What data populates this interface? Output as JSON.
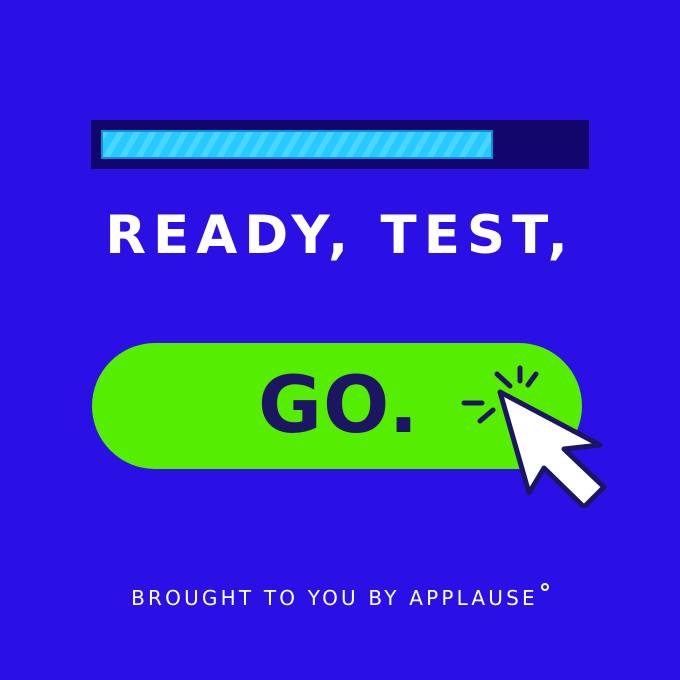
{
  "colors": {
    "background": "#2b10e6",
    "progress_track": "#12066d",
    "progress_fill": "#27c9ff",
    "headline": "#ffffff",
    "go_pill": "#56ee00",
    "go_text": "#1c1662",
    "cursor_fill": "#ffffff",
    "cursor_outline": "#1c1662",
    "byline": "#ffffff"
  },
  "progress": {
    "value_fraction": 0.82
  },
  "headline": {
    "text": "READY, TEST,"
  },
  "go_button": {
    "label": "GO."
  },
  "cursor": {
    "icon": "arrow-pointer-click-icon"
  },
  "byline": {
    "text": "BROUGHT TO YOU BY APPLAUSE"
  }
}
